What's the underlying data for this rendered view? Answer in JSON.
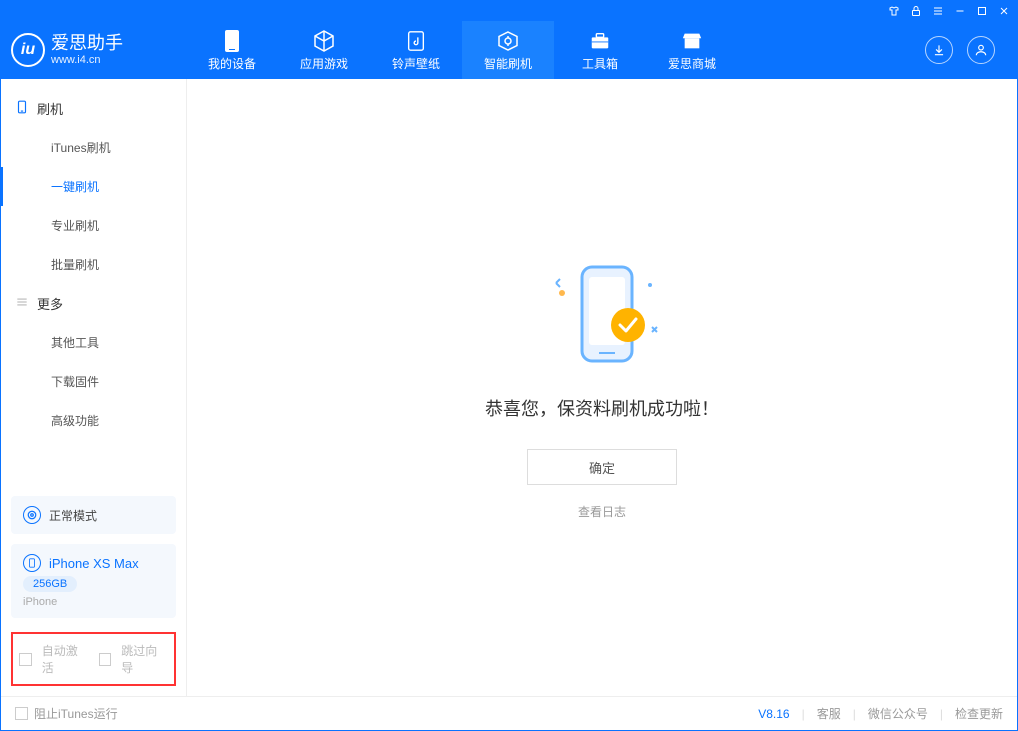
{
  "app": {
    "name": "爱思助手",
    "url": "www.i4.cn"
  },
  "nav": {
    "tabs": [
      {
        "label": "我的设备"
      },
      {
        "label": "应用游戏"
      },
      {
        "label": "铃声壁纸"
      },
      {
        "label": "智能刷机"
      },
      {
        "label": "工具箱"
      },
      {
        "label": "爱思商城"
      }
    ]
  },
  "sidebar": {
    "group1": {
      "title": "刷机"
    },
    "items1": [
      {
        "label": "iTunes刷机"
      },
      {
        "label": "一键刷机"
      },
      {
        "label": "专业刷机"
      },
      {
        "label": "批量刷机"
      }
    ],
    "group2": {
      "title": "更多"
    },
    "items2": [
      {
        "label": "其他工具"
      },
      {
        "label": "下载固件"
      },
      {
        "label": "高级功能"
      }
    ],
    "mode": "正常模式",
    "device": {
      "name": "iPhone XS Max",
      "storage": "256GB",
      "type": "iPhone"
    },
    "options": {
      "auto_activate": "自动激活",
      "skip_wizard": "跳过向导"
    }
  },
  "main": {
    "success_text": "恭喜您，保资料刷机成功啦！",
    "confirm": "确定",
    "view_log": "查看日志"
  },
  "footer": {
    "block_itunes": "阻止iTunes运行",
    "version": "V8.16",
    "support": "客服",
    "wechat": "微信公众号",
    "check_update": "检查更新"
  }
}
